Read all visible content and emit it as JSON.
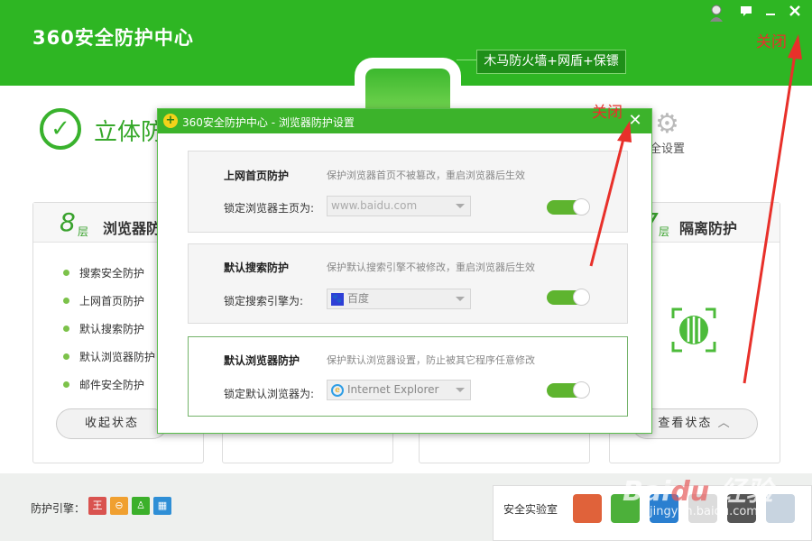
{
  "app": {
    "title": "360安全防护中心"
  },
  "header": {
    "trojan_badge": "木马防火墙+网盾+保镖"
  },
  "status": {
    "title": "立体防",
    "settings_label": "全设置"
  },
  "cards": [
    {
      "layer": "8",
      "layer_unit": "层",
      "title": "浏览器防",
      "items": [
        "搜索安全防护",
        "上网首页防护",
        "默认搜索防护",
        "默认浏览器防护",
        "邮件安全防护"
      ],
      "pill": "收起状态"
    },
    {
      "layer": "7",
      "layer_unit": "层",
      "title": "隔离防护",
      "pill": "查看状态"
    }
  ],
  "footer": {
    "engine_label": "防护引擎：",
    "lab_label": "安全实验室"
  },
  "annotations": {
    "close_note_1": "关闭",
    "close_note_2": "关闭"
  },
  "dialog": {
    "title": "360安全防护中心 - 浏览器防护设置",
    "sections": [
      {
        "heading": "上网首页防护",
        "desc": "保护浏览器首页不被篡改，重启浏览器后生效",
        "field_label": "锁定浏览器主页为:",
        "value": "www.baidu.com",
        "toggle": "on"
      },
      {
        "heading": "默认搜索防护",
        "desc": "保护默认搜索引擎不被修改，重启浏览器后生效",
        "field_label": "锁定搜索引擎为:",
        "value": "百度",
        "toggle": "on"
      },
      {
        "heading": "默认浏览器防护",
        "desc": "保护默认浏览器设置，防止被其它程序任意修改",
        "field_label": "锁定默认浏览器为:",
        "value": "Internet Explorer",
        "toggle": "on"
      }
    ]
  },
  "colors": {
    "brand_green": "#2eb623",
    "annotation_red": "#e8302a"
  },
  "watermark": {
    "logo": "Bai du 经验",
    "url": "jingyan.baidu.com"
  }
}
